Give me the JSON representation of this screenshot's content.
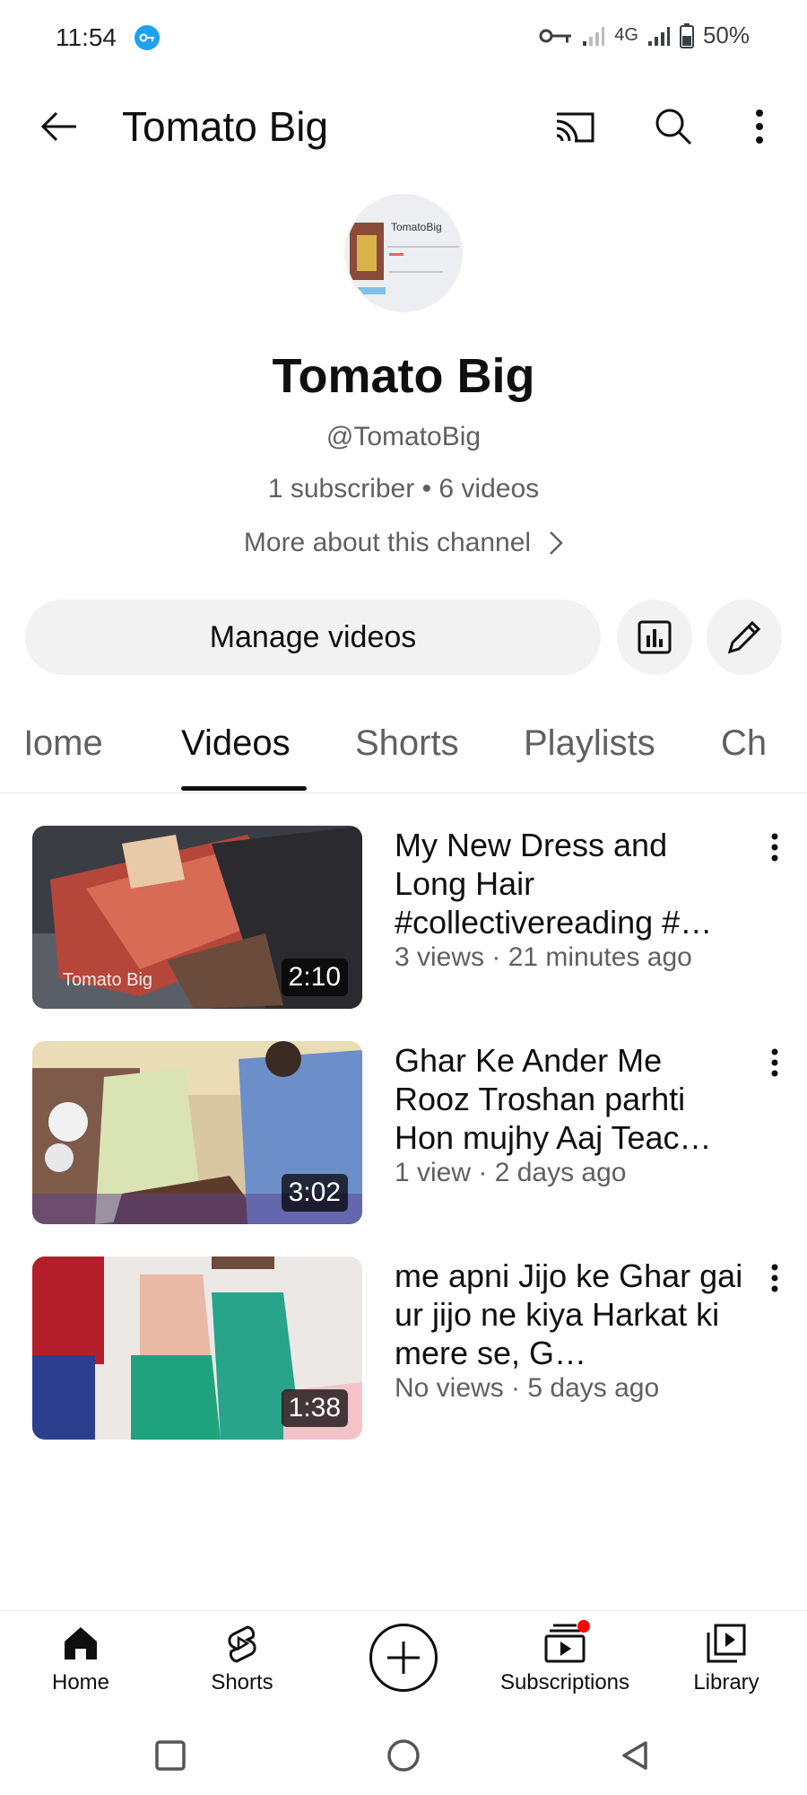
{
  "status_bar": {
    "time": "11:54",
    "network": "4G",
    "battery": "50%"
  },
  "app_bar": {
    "title": "Tomato Big"
  },
  "channel": {
    "name": "Tomato Big",
    "handle": "@TomatoBig",
    "stats": "1 subscriber • 6 videos",
    "more_about": "More about this channel",
    "avatar_text": "TomatoBig"
  },
  "actions": {
    "manage_videos": "Manage videos"
  },
  "tabs": [
    {
      "label": "Home"
    },
    {
      "label": "Videos",
      "active": true
    },
    {
      "label": "Shorts"
    },
    {
      "label": "Playlists"
    },
    {
      "label": "Ch"
    }
  ],
  "videos": [
    {
      "title": "My New Dress and Long Hair #collectivereading #…",
      "meta": "3 views · 21 minutes ago",
      "duration": "2:10",
      "watermark": "Tomato Big"
    },
    {
      "title": "Ghar Ke Ander Me Rooz Troshan parhti Hon mujhy Aaj Teac…",
      "meta": "1 view · 2 days ago",
      "duration": "3:02"
    },
    {
      "title": "me apni Jijo ke Ghar gai ur jijo ne kiya Harkat ki mere se, G…",
      "meta": "No views · 5 days ago",
      "duration": "1:38"
    }
  ],
  "bottom_nav": {
    "home": "Home",
    "shorts": "Shorts",
    "subscriptions": "Subscriptions",
    "library": "Library"
  },
  "colors": {
    "text_primary": "#0f0f0f",
    "text_secondary": "#606060",
    "chip_bg": "#f2f2f2",
    "notification_dot": "#ff0000"
  }
}
